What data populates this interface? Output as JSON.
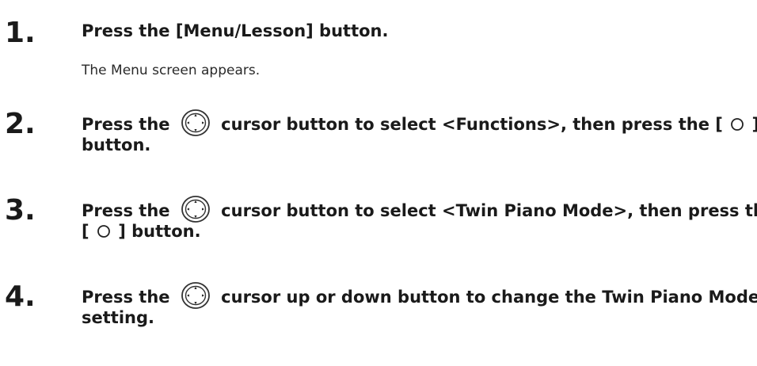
{
  "steps": [
    {
      "number": "1.",
      "line1": "Press the [Menu/Lesson] button.",
      "note": "The Menu screen appears."
    },
    {
      "number": "2.",
      "pre": "Press the",
      "post": "cursor button to select <Functions>, then press the [",
      "end": "]",
      "line2": "button."
    },
    {
      "number": "3.",
      "pre": "Press the",
      "post": "cursor button to select <Twin Piano Mode>, then press the",
      "line2_open": "[",
      "line2_close": "] button."
    },
    {
      "number": "4.",
      "pre": "Press the",
      "post": "cursor up or down button to change the Twin Piano Mode",
      "line2": "setting."
    }
  ],
  "icons": {
    "cursor": "cursor-pad-icon",
    "enter": "circle-button-icon"
  }
}
